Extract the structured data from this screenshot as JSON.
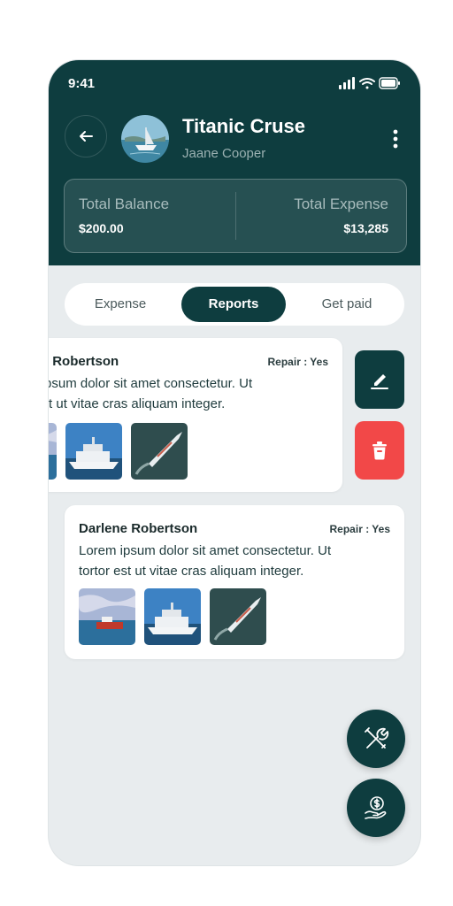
{
  "status_bar": {
    "time": "9:41"
  },
  "header": {
    "title": "Titanic Cruse",
    "subtitle": "Jaane Cooper",
    "balance": {
      "total_balance_label": "Total Balance",
      "total_balance_value": "$200.00",
      "total_expense_label": "Total Expense",
      "total_expense_value": "$13,285"
    }
  },
  "tabs": [
    {
      "label": "Expense",
      "active": false
    },
    {
      "label": "Reports",
      "active": true
    },
    {
      "label": "Get paid",
      "active": false
    }
  ],
  "reports": [
    {
      "name": "Darlene Robertson",
      "repair": "Repair : Yes",
      "line1": "Lorem ipsum dolor sit amet consectetur. Ut",
      "line2": "tortor est ut vitae cras aliquam integer.",
      "swiped": true
    },
    {
      "name": "Darlene Robertson",
      "repair": "Repair : Yes",
      "line1": "Lorem ipsum dolor sit amet consectetur. Ut",
      "line2": "tortor est ut vitae cras aliquam integer.",
      "swiped": false
    }
  ],
  "colors": {
    "primary": "#0e3d3f",
    "delete": "#f24848",
    "background": "#e8ecee"
  },
  "icons": {
    "back": "arrow-left-icon",
    "more": "more-vertical-icon",
    "edit": "pencil-icon",
    "delete": "trash-icon",
    "tools": "wrench-screwdriver-icon",
    "get_paid": "hand-dollar-icon"
  }
}
